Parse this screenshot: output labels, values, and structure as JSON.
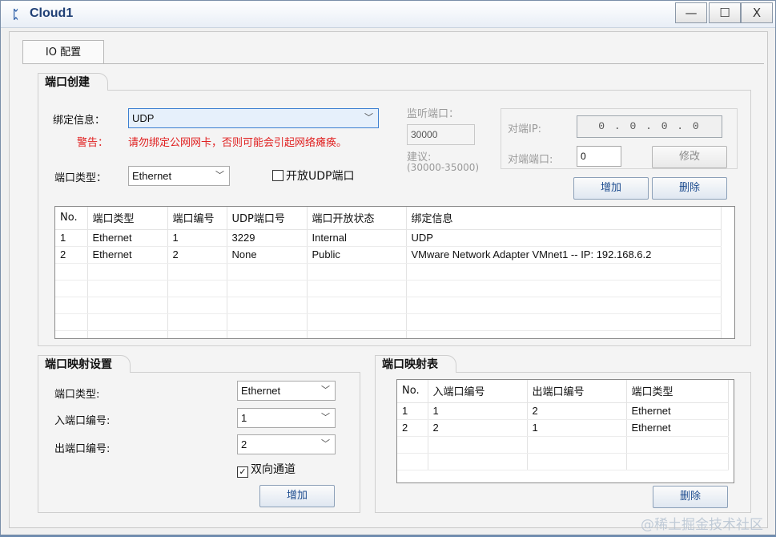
{
  "window": {
    "title": "Cloud1",
    "minimize": "—",
    "maximize": "☐",
    "close": "X"
  },
  "tab": {
    "label": "IO 配置"
  },
  "port_create": {
    "title": "端口创建",
    "bind_label": "绑定信息：",
    "bind_value": "UDP",
    "warning_label": "警告：",
    "warning_text": "请勿绑定公网网卡，否则可能会引起网络瘫痪。",
    "port_type_label": "端口类型：",
    "port_type_value": "Ethernet",
    "open_udp_label": "开放UDP端口",
    "open_udp_checked": false,
    "listen_port_label": "监听端口：",
    "listen_port_value": "30000",
    "suggest_label": "建议:",
    "suggest_range": "(30000-35000)",
    "peer_ip_label": "对端IP:",
    "peer_ip_value": "0 . 0 . 0 . 0",
    "peer_port_label": "对端端口:",
    "peer_port_value": "0",
    "modify_button": "修改",
    "add_button": "增加",
    "delete_button": "删除"
  },
  "port_table": {
    "headers": [
      "No.",
      "端口类型",
      "端口编号",
      "UDP端口号",
      "端口开放状态",
      "绑定信息"
    ],
    "rows": [
      [
        "1",
        "Ethernet",
        "1",
        "3229",
        "Internal",
        "UDP"
      ],
      [
        "2",
        "Ethernet",
        "2",
        "None",
        "Public",
        "VMware Network Adapter VMnet1 -- IP: 192.168.6.2"
      ]
    ]
  },
  "mapping_settings": {
    "title": "端口映射设置",
    "port_type_label": "端口类型:",
    "port_type_value": "Ethernet",
    "in_port_label": "入端口编号:",
    "in_port_value": "1",
    "out_port_label": "出端口编号:",
    "out_port_value": "2",
    "bidirectional_label": "双向通道",
    "bidirectional_checked": true,
    "add_button": "增加"
  },
  "mapping_table": {
    "title": "端口映射表",
    "headers": [
      "No.",
      "入端口编号",
      "出端口编号",
      "端口类型"
    ],
    "rows": [
      [
        "1",
        "1",
        "2",
        "Ethernet"
      ],
      [
        "2",
        "2",
        "1",
        "Ethernet"
      ]
    ],
    "delete_button": "删除"
  },
  "watermark": "@稀土掘金技术社区"
}
